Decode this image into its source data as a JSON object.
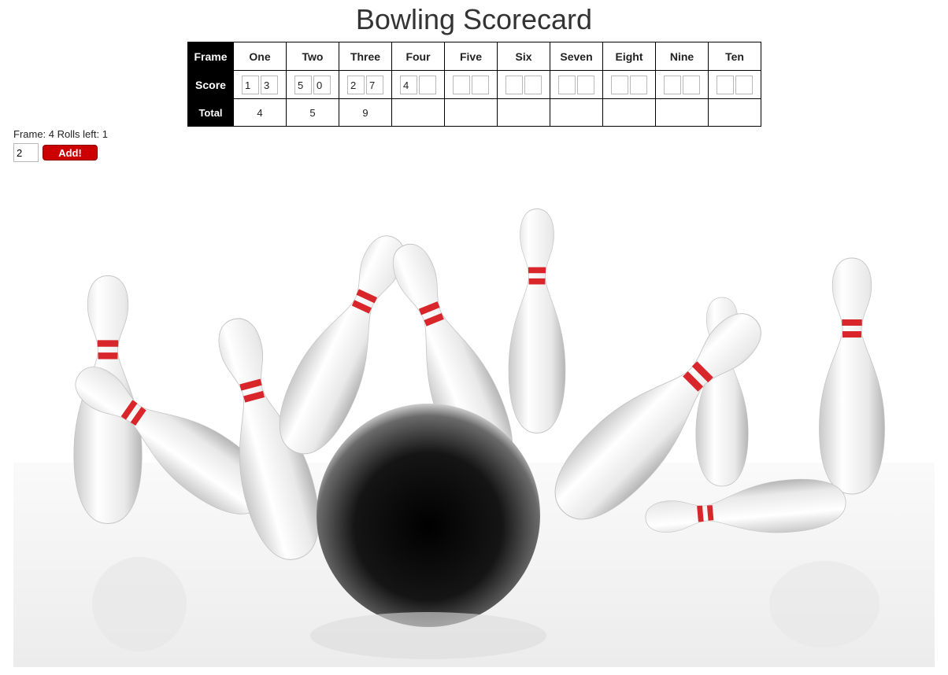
{
  "title": "Bowling Scorecard",
  "table": {
    "frame_label": "Frame",
    "score_label": "Score",
    "total_label": "Total",
    "frames": [
      {
        "name": "One",
        "rolls": [
          "1",
          "3"
        ],
        "total": "4"
      },
      {
        "name": "Two",
        "rolls": [
          "5",
          "0"
        ],
        "total": "5"
      },
      {
        "name": "Three",
        "rolls": [
          "2",
          "7"
        ],
        "total": "9"
      },
      {
        "name": "Four",
        "rolls": [
          "4",
          ""
        ],
        "total": ""
      },
      {
        "name": "Five",
        "rolls": [
          "",
          ""
        ],
        "total": ""
      },
      {
        "name": "Six",
        "rolls": [
          "",
          ""
        ],
        "total": ""
      },
      {
        "name": "Seven",
        "rolls": [
          "",
          ""
        ],
        "total": ""
      },
      {
        "name": "Eight",
        "rolls": [
          "",
          ""
        ],
        "total": ""
      },
      {
        "name": "Nine",
        "rolls": [
          "",
          ""
        ],
        "total": ""
      },
      {
        "name": "Ten",
        "rolls": [
          "",
          ""
        ],
        "total": ""
      }
    ]
  },
  "status": {
    "text": "Frame: 4 Rolls left: 1"
  },
  "entry": {
    "value": "2"
  },
  "add_button": {
    "label": "Add!"
  },
  "colors": {
    "accent": "#cc0000",
    "header_bg": "#000000",
    "pin_stripe": "#d8262a"
  }
}
